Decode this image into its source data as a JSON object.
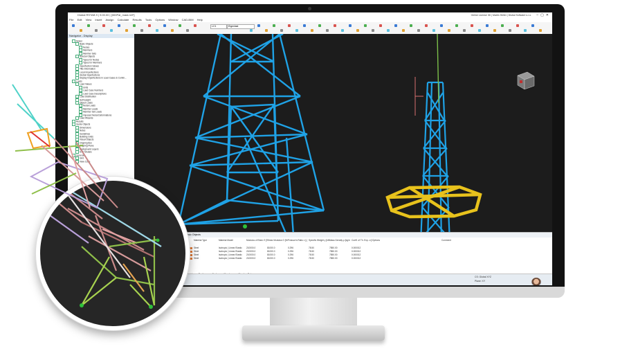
{
  "app": {
    "title": "Dlubal RSTAB 9 | 9.00.00 | [300Pal_mast.rs9*]",
    "license": "Online License 3D | Martin Heller | Dlubal Software s.r.o."
  },
  "menu": [
    "File",
    "Edit",
    "View",
    "Insert",
    "Assign",
    "Calculate",
    "Results",
    "Tools",
    "Options",
    "Window",
    "CAD-BIM",
    "Help"
  ],
  "toolbar": {
    "combo_loadcase": "LC1",
    "combo_display": "Eigenlast"
  },
  "navigator": {
    "title": "Navigator - Display",
    "items": [
      "Model",
      "Basic Objects",
      "Nodes",
      "Members",
      "Member Sets",
      "Special Objects",
      "Types for Nodes",
      "Types for Members",
      "Imperfection Values",
      "Title Information",
      "Local Imperfections",
      "Global Imperfections",
      "Display Imperfections in Load Cases & Combi...",
      "Loads",
      "Load Values",
      "Units",
      "Load Case Numbers",
      "Load Case Descriptions",
      "Load Distribution",
      "Self-weight",
      "Object Loads",
      "Nodal Loads",
      "Member Loads",
      "Member Set Loads",
      "Imposed Nodal Deformations",
      "Load Wizards",
      "Results",
      "Guide Objects",
      "Dimensions",
      "Notes",
      "Guidelines",
      "Building Grids",
      "Visual Objects",
      "Clipping Box",
      "Clipping Plane",
      "Background Layers",
      "DXF Models",
      "General",
      "Grid",
      "View Cube"
    ]
  },
  "panel": {
    "filter_label": "Basic Objects",
    "headers": [
      "Material Type",
      "Material Model",
      "Modulus of Elast. E [N/mm²]",
      "Shear Modulus G [N/mm²]",
      "Poisson's Ratio ν [-]",
      "Specific Weight γ [kN/m³]",
      "Mass Density ρ [kg/m³]",
      "Coeff. of Th. Exp. α [1/°C]",
      "Options",
      "Comment"
    ],
    "rows": [
      {
        "type": "Steel",
        "model": "Isotropic | Linear Elastic",
        "e": "210000.0",
        "g": "81000.0",
        "nu": "0.296",
        "gamma": "78.50",
        "rho": "7850.00",
        "alpha": "0.000012"
      },
      {
        "type": "Steel",
        "model": "Isotropic | Linear Elastic",
        "e": "210000.0",
        "g": "81000.0",
        "nu": "0.296",
        "gamma": "78.50",
        "rho": "7850.00",
        "alpha": "0.000012"
      },
      {
        "type": "Steel",
        "model": "Isotropic | Linear Elastic",
        "e": "210000.0",
        "g": "81000.0",
        "nu": "0.296",
        "gamma": "78.50",
        "rho": "7850.00",
        "alpha": "0.000012"
      },
      {
        "type": "Steel",
        "model": "Isotropic | Linear Elastic",
        "e": "210000.0",
        "g": "81000.0",
        "nu": "0.296",
        "gamma": "78.50",
        "rho": "7850.00",
        "alpha": "0.000012"
      }
    ],
    "tabs": [
      "Materials",
      "Sections",
      "Nodes",
      "Members",
      "Member Sets"
    ]
  },
  "status": {
    "cs": "CS: Global XYZ",
    "plane": "Plane: XY"
  },
  "colors": {
    "members_blue": "#1fa2e6",
    "ring_yellow": "#e8c21c",
    "support_green": "#2fbf3a"
  }
}
